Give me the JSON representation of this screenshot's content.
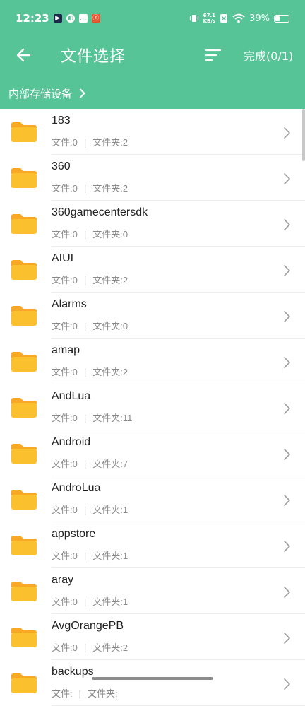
{
  "status": {
    "time": "12:23",
    "net_speed_value": "67.1",
    "net_speed_unit": "KB/s",
    "battery": "39%"
  },
  "appbar": {
    "title": "文件选择",
    "done_label": "完成(0/1)"
  },
  "breadcrumb": {
    "label": "内部存储设备"
  },
  "meta_labels": {
    "files": "文件:",
    "folders": "文件夹:",
    "separator": "|"
  },
  "colors": {
    "header_bg": "#56c497",
    "folder": "#fbc02d",
    "folder_tab": "#f9a825"
  },
  "items": [
    {
      "name": "183",
      "files": "0",
      "folders": "2"
    },
    {
      "name": "360",
      "files": "0",
      "folders": "2"
    },
    {
      "name": "360gamecentersdk",
      "files": "0",
      "folders": "0"
    },
    {
      "name": "AIUI",
      "files": "0",
      "folders": "2"
    },
    {
      "name": "Alarms",
      "files": "0",
      "folders": "0"
    },
    {
      "name": "amap",
      "files": "0",
      "folders": "2"
    },
    {
      "name": "AndLua",
      "files": "0",
      "folders": "11"
    },
    {
      "name": "Android",
      "files": "0",
      "folders": "7"
    },
    {
      "name": "AndroLua",
      "files": "0",
      "folders": "1"
    },
    {
      "name": "appstore",
      "files": "0",
      "folders": "1"
    },
    {
      "name": "aray",
      "files": "0",
      "folders": "1"
    },
    {
      "name": "AvgOrangePB",
      "files": "0",
      "folders": "2"
    },
    {
      "name": "backups",
      "files": "",
      "folders": ""
    }
  ]
}
